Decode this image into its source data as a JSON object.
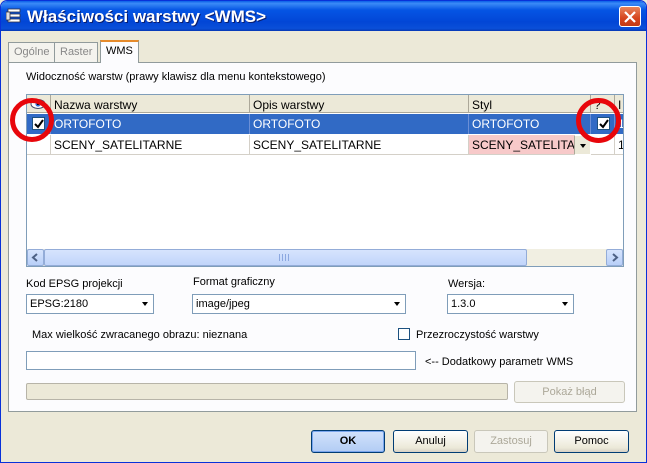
{
  "window": {
    "title": "Właściwości warstwy <WMS>"
  },
  "tabs": [
    {
      "label": "Ogólne",
      "active": false
    },
    {
      "label": "Raster",
      "active": false
    },
    {
      "label": "WMS",
      "active": true
    }
  ],
  "layers_section": {
    "label": "Widoczność warstw (prawy klawisz dla menu kontekstowego)",
    "columns": {
      "visible_icon": "eye-icon",
      "name": "Nazwa warstwy",
      "description": "Opis warstwy",
      "style": "Styl",
      "query": "?",
      "extra": "I"
    },
    "rows": [
      {
        "visible": true,
        "name": "ORTOFOTO",
        "description": "ORTOFOTO",
        "style": "ORTOFOTO",
        "query": true,
        "extra": "1",
        "selected": true
      },
      {
        "visible": false,
        "name": "SCENY_SATELITARNE",
        "description": "SCENY_SATELITARNE",
        "style": "SCENY_SATELITA",
        "query": false,
        "extra": "1",
        "selected": false
      }
    ]
  },
  "epsg": {
    "label": "Kod EPSG projekcji",
    "value": "EPSG:2180"
  },
  "format": {
    "label": "Format graficzny",
    "value": "image/jpeg"
  },
  "version": {
    "label": "Wersja:",
    "value": "1.3.0"
  },
  "max_size": {
    "label": "Max wielkość zwracanego obrazu: nieznana"
  },
  "transparency": {
    "label": "Przezroczystość warstwy",
    "checked": false
  },
  "extra_param": {
    "value": "",
    "label": "<-- Dodatkowy parametr WMS"
  },
  "error_button": {
    "label": "Pokaż błąd"
  },
  "buttons": {
    "ok": "OK",
    "cancel": "Anuluj",
    "apply": "Zastosuj",
    "help": "Pomoc"
  },
  "colors": {
    "selection": "#316ac5",
    "title_bar": "#0555e4",
    "highlight_circle": "#e8060b",
    "style_invalid": "#f7c9c9"
  }
}
